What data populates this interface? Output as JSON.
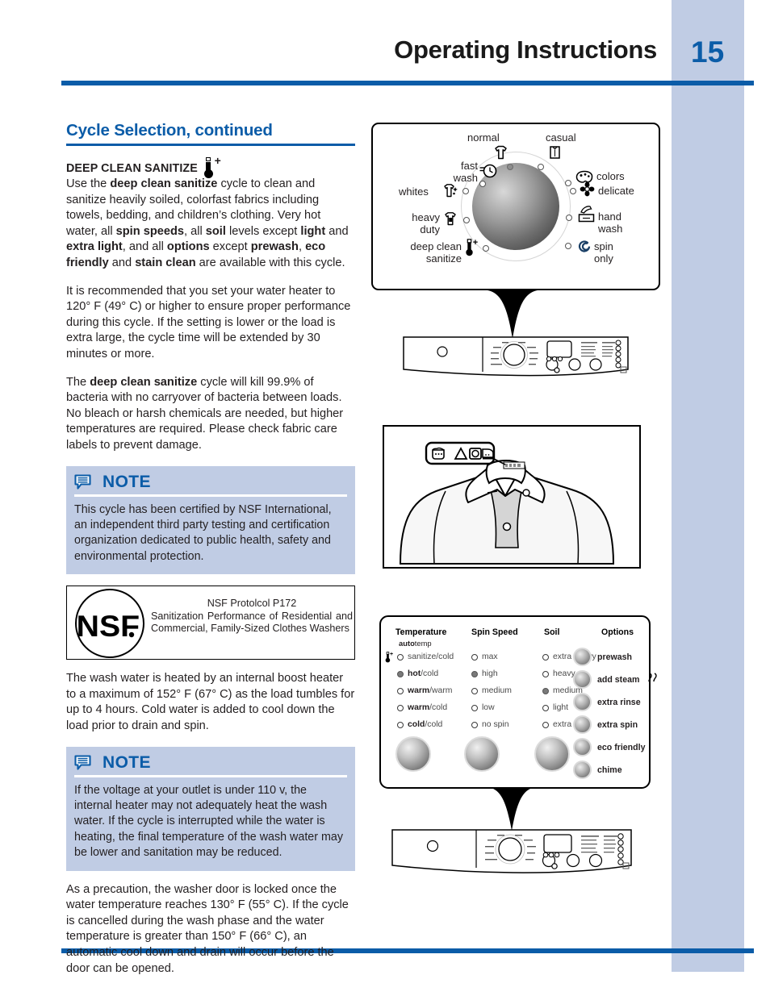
{
  "header": {
    "title": "Operating Instructions",
    "page_number": "15"
  },
  "section": {
    "title": "Cycle Selection, continued",
    "subhead": "DEEP CLEAN SANITIZE",
    "subhead_icon": "thermometer-plus-icon",
    "paragraphs": [
      "Use the <b>deep clean sanitize</b> cycle to clean and sanitize heavily soiled, colorfast fabrics including towels, bedding, and children’s clothing. Very hot water, all <b>spin speeds</b>, all <b>soil</b> levels except <b>light</b> and <b>extra light</b>, and all <b>options</b> except <b>prewash</b>, <b>eco friendly</b> and <b>stain clean</b> are available with this cycle.",
      "It is recommended that you set your water heater to 120° F (49° C) or higher to ensure proper performance during this cycle. If the setting is lower or the load is extra large, the cycle time will be extended by 30 minutes or more.",
      "The <b>deep clean sanitize</b> cycle will kill 99.9% of bacteria with no carryover of bacteria between loads. No bleach or harsh chemicals are needed, but higher temperatures are required. Please check fabric care labels to prevent damage."
    ],
    "paragraph_after_nsf": "The wash water is heated by an internal boost heater to a maximum of 152° F (67° C) as the load tumbles for up to 4 hours. Cold water is added to cool down the load prior to drain and spin.",
    "paragraph_final": "As a precaution, the washer door is locked once the water temperature reaches 130° F (55° C). If the cycle is cancelled during the wash phase and the water temperature is greater than 150° F (66° C), an automatic cool down and drain will occur before the door can be opened."
  },
  "notes": [
    {
      "title": "NOTE",
      "icon": "note-bubble-icon",
      "body": "This cycle has been certified by NSF International, an independent third party testing and certification organization dedicated to public health, safety and environmental protection."
    },
    {
      "title": "NOTE",
      "icon": "note-bubble-icon",
      "body": "If the voltage at your outlet is under 110 v, the internal heater may not adequately heat the wash water. If the cycle is interrupted while the water is heating, the final temperature of the wash water may be lower and sanitation may be reduced."
    }
  ],
  "nsf": {
    "logo_text": "NSF",
    "logo_mark": "registered-trademark-icon",
    "line1": "NSF Protolcol P172",
    "line2": "Sanitization Performance of Residential and Commercial, Family-Sized Clothes Washers"
  },
  "dial_figure": {
    "caption_icons": {
      "normal": "tshirt-icon",
      "casual": "dress-shirt-icon",
      "fast_wash": "clock-icon",
      "colors": "palette-icon",
      "whites": "sparkle-shirt-icon",
      "delicate": "flower-icon",
      "heavy_duty": "heavy-shirt-icon",
      "hand_wash": "hand-in-basin-icon",
      "deep_clean_sanitize": "thermometer-plus-icon",
      "spin_only": "spiral-icon"
    },
    "cycles_top": [
      "normal",
      "casual"
    ],
    "cycles_left": [
      "fast wash",
      "whites",
      "heavy duty",
      "deep clean sanitize"
    ],
    "cycles_right": [
      "colors",
      "delicate",
      "hand wash",
      "spin only"
    ],
    "selected": "normal"
  },
  "shirt_figure": {
    "care_symbols": [
      "wash-tub-icon",
      "bleach-triangle-icon",
      "tumble-dry-icon",
      "iron-icon"
    ],
    "label_name": "care-label"
  },
  "options_panel": {
    "columns": [
      {
        "header": "Temperature",
        "subheader_bold": "auto",
        "subheader_rest": "temp",
        "icon": "thermometer-plus-icon",
        "items": [
          {
            "bold": "",
            "rest": "sanitize/cold",
            "selected": false
          },
          {
            "bold": "hot",
            "rest": "/cold",
            "selected": true
          },
          {
            "bold": "warm",
            "rest": "/warm",
            "selected": false
          },
          {
            "bold": "warm",
            "rest": "/cold",
            "selected": false
          },
          {
            "bold": "cold",
            "rest": "/cold",
            "selected": false
          }
        ]
      },
      {
        "header": "Spin Speed",
        "items": [
          {
            "bold": "",
            "rest": "max",
            "selected": false
          },
          {
            "bold": "",
            "rest": "high",
            "selected": true
          },
          {
            "bold": "",
            "rest": "medium",
            "selected": false
          },
          {
            "bold": "",
            "rest": "low",
            "selected": false
          },
          {
            "bold": "",
            "rest": "no spin",
            "selected": false
          }
        ]
      },
      {
        "header": "Soil",
        "items": [
          {
            "bold": "",
            "rest": "extra heavy",
            "selected": false
          },
          {
            "bold": "",
            "rest": "heavy",
            "selected": false
          },
          {
            "bold": "",
            "rest": "medium",
            "selected": true
          },
          {
            "bold": "",
            "rest": "light",
            "selected": false
          },
          {
            "bold": "",
            "rest": "extra light",
            "selected": false
          }
        ]
      }
    ],
    "options_header": "Options",
    "options": [
      {
        "label": "prewash",
        "icon": ""
      },
      {
        "label": "add steam",
        "icon": "steam-icon"
      },
      {
        "label": "extra rinse",
        "icon": ""
      },
      {
        "label": "extra spin",
        "icon": ""
      },
      {
        "label": "eco friendly",
        "icon": ""
      },
      {
        "label": "chime",
        "icon": ""
      }
    ]
  },
  "colors": {
    "accent_blue": "#0b5ca8",
    "band_blue": "#c0cce4",
    "text": "#231f20"
  }
}
